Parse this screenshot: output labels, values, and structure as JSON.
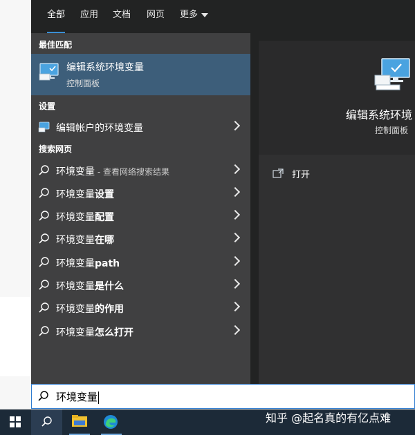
{
  "tabs": [
    {
      "label": "全部",
      "active": true
    },
    {
      "label": "应用",
      "active": false
    },
    {
      "label": "文档",
      "active": false
    },
    {
      "label": "网页",
      "active": false
    },
    {
      "label": "更多",
      "active": false
    }
  ],
  "sections": {
    "best_match": "最佳匹配",
    "settings": "设置",
    "web": "搜索网页"
  },
  "best_match": {
    "title": "编辑系统环境变量",
    "subtitle": "控制面板",
    "icon": "monitor-settings-icon"
  },
  "settings_items": [
    {
      "label": "编辑帐户的环境变量",
      "icon": "monitor-settings-icon"
    }
  ],
  "web_items": [
    {
      "label": "环境变量",
      "suffix": "",
      "hint": " - 查看网络搜索结果"
    },
    {
      "label": "环境变量",
      "suffix": "设置",
      "hint": ""
    },
    {
      "label": "环境变量",
      "suffix": "配置",
      "hint": ""
    },
    {
      "label": "环境变量",
      "suffix": "在哪",
      "hint": ""
    },
    {
      "label": "环境变量",
      "suffix": "path",
      "hint": ""
    },
    {
      "label": "环境变量",
      "suffix": "是什么",
      "hint": ""
    },
    {
      "label": "环境变量",
      "suffix": "的作用",
      "hint": ""
    },
    {
      "label": "环境变量",
      "suffix": "怎么打开",
      "hint": ""
    }
  ],
  "detail": {
    "title": "编辑系统环境",
    "subtitle": "控制面板",
    "open_label": "打开"
  },
  "search": {
    "value": "环境变量"
  },
  "taskbar": {
    "watermark": "知乎 @起名真的有亿点难"
  },
  "colors": {
    "accent": "#3a8fd4",
    "selected_row": "#3d5e7a",
    "taskbar": "#1c2a38"
  }
}
